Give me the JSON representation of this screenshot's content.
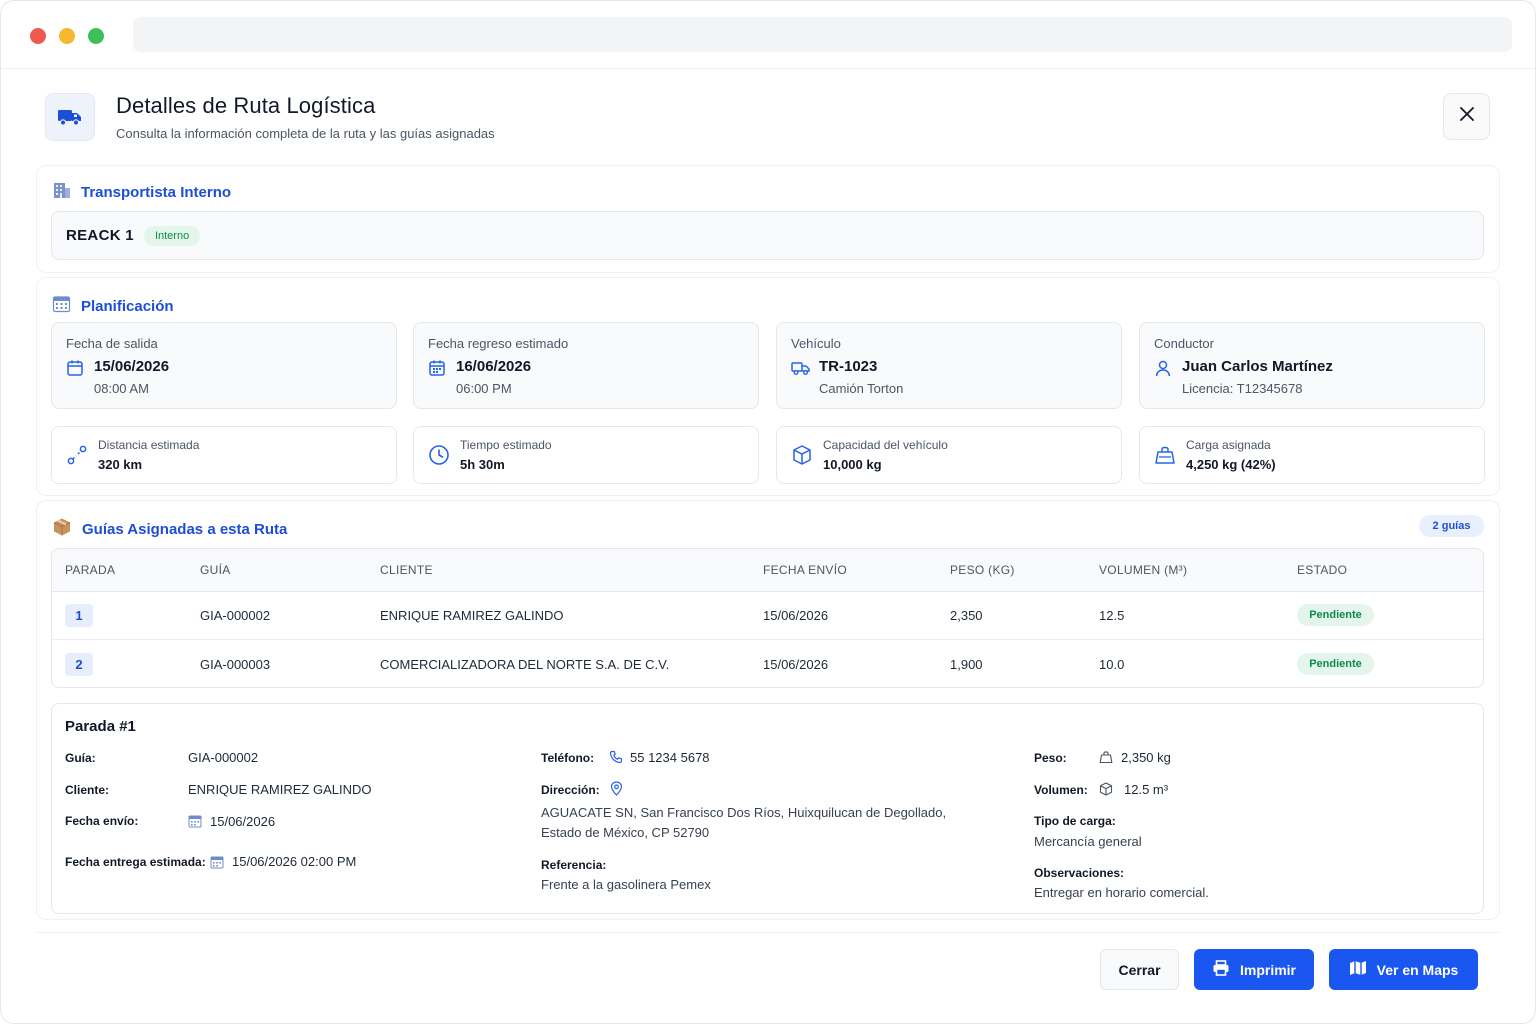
{
  "header": {
    "title": "Detalles de Ruta Logística",
    "subtitle": "Consulta la información completa de la ruta y las guías asignadas"
  },
  "carrier": {
    "section_title": "Transportista Interno",
    "name": "REACK 1",
    "badge": "Interno"
  },
  "planning": {
    "section_title": "Planificación",
    "cards": [
      {
        "label": "Fecha de salida",
        "value": "15/06/2026",
        "sub": "08:00 AM",
        "icon": "calendar-icon"
      },
      {
        "label": "Fecha regreso estimado",
        "value": "16/06/2026",
        "sub": "06:00 PM",
        "icon": "calendar-grid-icon"
      },
      {
        "label": "Vehículo",
        "value": "TR-1023",
        "sub": "Camión Torton",
        "icon": "truck-icon"
      },
      {
        "label": "Conductor",
        "value": "Juan Carlos Martínez",
        "sub": "Licencia: T12345678",
        "icon": "user-icon"
      }
    ],
    "metrics": [
      {
        "label": "Distancia estimada",
        "value": "320 km",
        "icon": "route-icon"
      },
      {
        "label": "Tiempo estimado",
        "value": "5h 30m",
        "icon": "clock-icon"
      },
      {
        "label": "Capacidad del vehículo",
        "value": "10,000 kg",
        "icon": "box-icon"
      },
      {
        "label": "Carga asignada",
        "value": "4,250 kg (42%)",
        "icon": "weight-icon"
      }
    ]
  },
  "guides": {
    "section_title": "Guías Asignadas a esta Ruta",
    "count_badge": "2 guías",
    "columns": [
      "PARADA",
      "GUÍA",
      "CLIENTE",
      "FECHA ENVÍO",
      "PESO (KG)",
      "VOLUMEN (M³)",
      "ESTADO"
    ],
    "rows": [
      {
        "stop": "1",
        "guide": "GIA-000002",
        "client": "ENRIQUE RAMIREZ GALINDO",
        "date": "15/06/2026",
        "weight": "2,350",
        "volume": "12.5",
        "status": "Pendiente"
      },
      {
        "stop": "2",
        "guide": "GIA-000003",
        "client": "COMERCIALIZADORA DEL NORTE S.A. DE C.V.",
        "date": "15/06/2026",
        "weight": "1,900",
        "volume": "10.0",
        "status": "Pendiente"
      }
    ]
  },
  "stop_detail": {
    "title": "Parada #1",
    "guide_label": "Guía:",
    "guide": "GIA-000002",
    "client_label": "Cliente:",
    "client": "ENRIQUE RAMIREZ GALINDO",
    "ship_date_label": "Fecha envío:",
    "ship_date": "15/06/2026",
    "delivery_label": "Fecha entrega estimada:",
    "delivery": "15/06/2026 02:00 PM",
    "phone_label": "Teléfono:",
    "phone": "55 1234 5678",
    "address_label": "Dirección:",
    "address_line1": "AGUACATE SN, San Francisco Dos Ríos, Huixquilucan de Degollado,",
    "address_line2": "Estado de México, CP 52790",
    "reference_label": "Referencia:",
    "reference": "Frente a la gasolinera Pemex",
    "weight_label": "Peso:",
    "weight": "2,350 kg",
    "volume_label": "Volumen:",
    "volume": "12.5 m³",
    "cargo_label": "Tipo de carga:",
    "cargo": "Mercancía general",
    "notes_label": "Observaciones:",
    "notes": "Entregar en horario comercial."
  },
  "footer": {
    "close_label": "Cerrar",
    "print_label": "Imprimir",
    "maps_label": "Ver en Maps"
  },
  "colors": {
    "accent": "#1a56f0",
    "section_title": "#1d4ed8",
    "success_bg": "#e4f6ec",
    "success_text": "#0f8a4b"
  }
}
